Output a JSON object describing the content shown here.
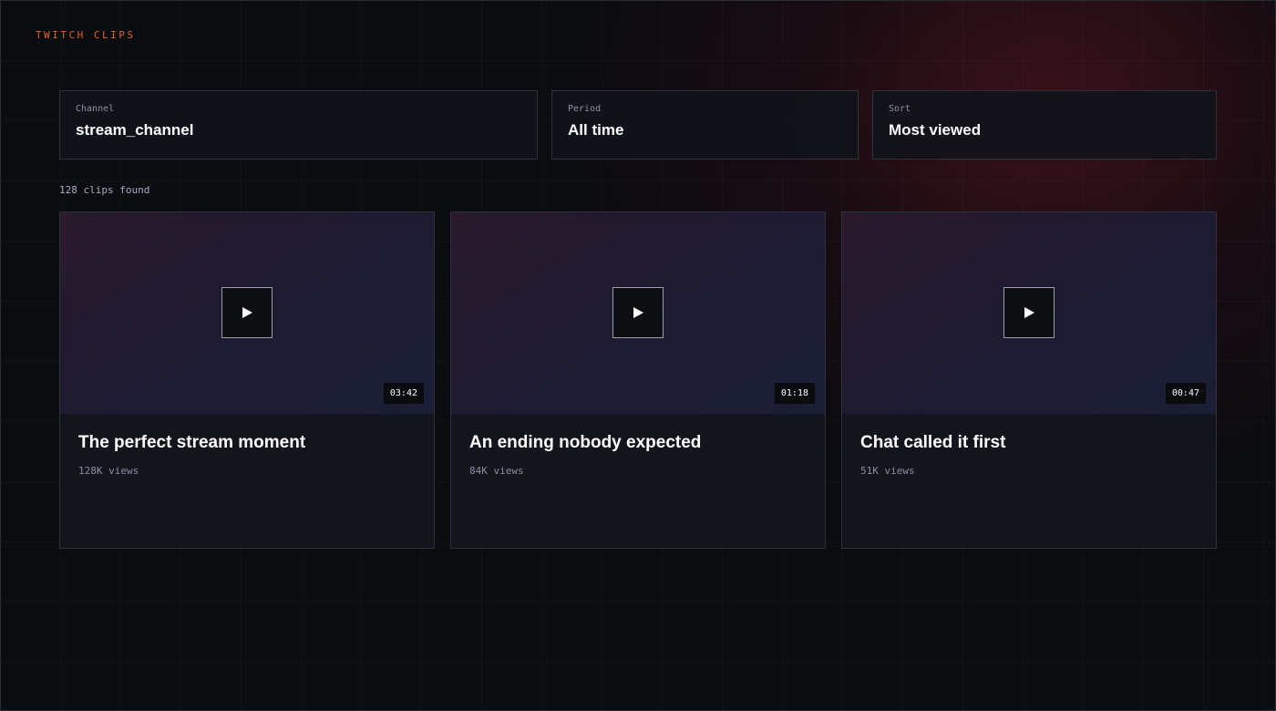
{
  "brand": "TWITCH CLIPS",
  "filters": {
    "channel": {
      "label": "Channel",
      "value": "stream_channel"
    },
    "period": {
      "label": "Period",
      "value": "All time"
    },
    "sort": {
      "label": "Sort",
      "value": "Most viewed"
    }
  },
  "results_count": "128 clips found",
  "clips": [
    {
      "title": "The perfect stream moment",
      "views": "128K views",
      "duration": "03:42",
      "icon": "play-icon"
    },
    {
      "title": "An ending nobody expected",
      "views": "84K views",
      "duration": "01:18",
      "icon": "play-icon"
    },
    {
      "title": "Chat called it first",
      "views": "51K views",
      "duration": "00:47",
      "icon": "play-icon"
    }
  ],
  "colors": {
    "accent": "#e0612f",
    "background": "#0b0c10",
    "card": "#13151d",
    "border": "#2e313a"
  }
}
